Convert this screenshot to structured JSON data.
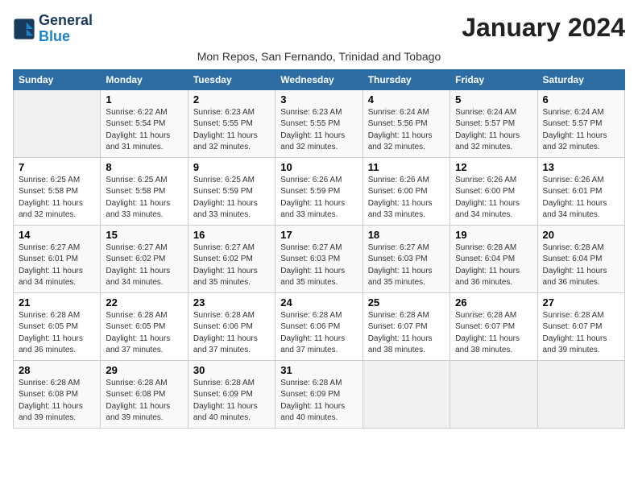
{
  "header": {
    "logo_line1": "General",
    "logo_line2": "Blue",
    "month_title": "January 2024",
    "location": "Mon Repos, San Fernando, Trinidad and Tobago"
  },
  "weekdays": [
    "Sunday",
    "Monday",
    "Tuesday",
    "Wednesday",
    "Thursday",
    "Friday",
    "Saturday"
  ],
  "weeks": [
    [
      {
        "day": "",
        "info": ""
      },
      {
        "day": "1",
        "info": "Sunrise: 6:22 AM\nSunset: 5:54 PM\nDaylight: 11 hours\nand 31 minutes."
      },
      {
        "day": "2",
        "info": "Sunrise: 6:23 AM\nSunset: 5:55 PM\nDaylight: 11 hours\nand 32 minutes."
      },
      {
        "day": "3",
        "info": "Sunrise: 6:23 AM\nSunset: 5:55 PM\nDaylight: 11 hours\nand 32 minutes."
      },
      {
        "day": "4",
        "info": "Sunrise: 6:24 AM\nSunset: 5:56 PM\nDaylight: 11 hours\nand 32 minutes."
      },
      {
        "day": "5",
        "info": "Sunrise: 6:24 AM\nSunset: 5:57 PM\nDaylight: 11 hours\nand 32 minutes."
      },
      {
        "day": "6",
        "info": "Sunrise: 6:24 AM\nSunset: 5:57 PM\nDaylight: 11 hours\nand 32 minutes."
      }
    ],
    [
      {
        "day": "7",
        "info": "Sunrise: 6:25 AM\nSunset: 5:58 PM\nDaylight: 11 hours\nand 32 minutes."
      },
      {
        "day": "8",
        "info": "Sunrise: 6:25 AM\nSunset: 5:58 PM\nDaylight: 11 hours\nand 33 minutes."
      },
      {
        "day": "9",
        "info": "Sunrise: 6:25 AM\nSunset: 5:59 PM\nDaylight: 11 hours\nand 33 minutes."
      },
      {
        "day": "10",
        "info": "Sunrise: 6:26 AM\nSunset: 5:59 PM\nDaylight: 11 hours\nand 33 minutes."
      },
      {
        "day": "11",
        "info": "Sunrise: 6:26 AM\nSunset: 6:00 PM\nDaylight: 11 hours\nand 33 minutes."
      },
      {
        "day": "12",
        "info": "Sunrise: 6:26 AM\nSunset: 6:00 PM\nDaylight: 11 hours\nand 34 minutes."
      },
      {
        "day": "13",
        "info": "Sunrise: 6:26 AM\nSunset: 6:01 PM\nDaylight: 11 hours\nand 34 minutes."
      }
    ],
    [
      {
        "day": "14",
        "info": "Sunrise: 6:27 AM\nSunset: 6:01 PM\nDaylight: 11 hours\nand 34 minutes."
      },
      {
        "day": "15",
        "info": "Sunrise: 6:27 AM\nSunset: 6:02 PM\nDaylight: 11 hours\nand 34 minutes."
      },
      {
        "day": "16",
        "info": "Sunrise: 6:27 AM\nSunset: 6:02 PM\nDaylight: 11 hours\nand 35 minutes."
      },
      {
        "day": "17",
        "info": "Sunrise: 6:27 AM\nSunset: 6:03 PM\nDaylight: 11 hours\nand 35 minutes."
      },
      {
        "day": "18",
        "info": "Sunrise: 6:27 AM\nSunset: 6:03 PM\nDaylight: 11 hours\nand 35 minutes."
      },
      {
        "day": "19",
        "info": "Sunrise: 6:28 AM\nSunset: 6:04 PM\nDaylight: 11 hours\nand 36 minutes."
      },
      {
        "day": "20",
        "info": "Sunrise: 6:28 AM\nSunset: 6:04 PM\nDaylight: 11 hours\nand 36 minutes."
      }
    ],
    [
      {
        "day": "21",
        "info": "Sunrise: 6:28 AM\nSunset: 6:05 PM\nDaylight: 11 hours\nand 36 minutes."
      },
      {
        "day": "22",
        "info": "Sunrise: 6:28 AM\nSunset: 6:05 PM\nDaylight: 11 hours\nand 37 minutes."
      },
      {
        "day": "23",
        "info": "Sunrise: 6:28 AM\nSunset: 6:06 PM\nDaylight: 11 hours\nand 37 minutes."
      },
      {
        "day": "24",
        "info": "Sunrise: 6:28 AM\nSunset: 6:06 PM\nDaylight: 11 hours\nand 37 minutes."
      },
      {
        "day": "25",
        "info": "Sunrise: 6:28 AM\nSunset: 6:07 PM\nDaylight: 11 hours\nand 38 minutes."
      },
      {
        "day": "26",
        "info": "Sunrise: 6:28 AM\nSunset: 6:07 PM\nDaylight: 11 hours\nand 38 minutes."
      },
      {
        "day": "27",
        "info": "Sunrise: 6:28 AM\nSunset: 6:07 PM\nDaylight: 11 hours\nand 39 minutes."
      }
    ],
    [
      {
        "day": "28",
        "info": "Sunrise: 6:28 AM\nSunset: 6:08 PM\nDaylight: 11 hours\nand 39 minutes."
      },
      {
        "day": "29",
        "info": "Sunrise: 6:28 AM\nSunset: 6:08 PM\nDaylight: 11 hours\nand 39 minutes."
      },
      {
        "day": "30",
        "info": "Sunrise: 6:28 AM\nSunset: 6:09 PM\nDaylight: 11 hours\nand 40 minutes."
      },
      {
        "day": "31",
        "info": "Sunrise: 6:28 AM\nSunset: 6:09 PM\nDaylight: 11 hours\nand 40 minutes."
      },
      {
        "day": "",
        "info": ""
      },
      {
        "day": "",
        "info": ""
      },
      {
        "day": "",
        "info": ""
      }
    ]
  ]
}
